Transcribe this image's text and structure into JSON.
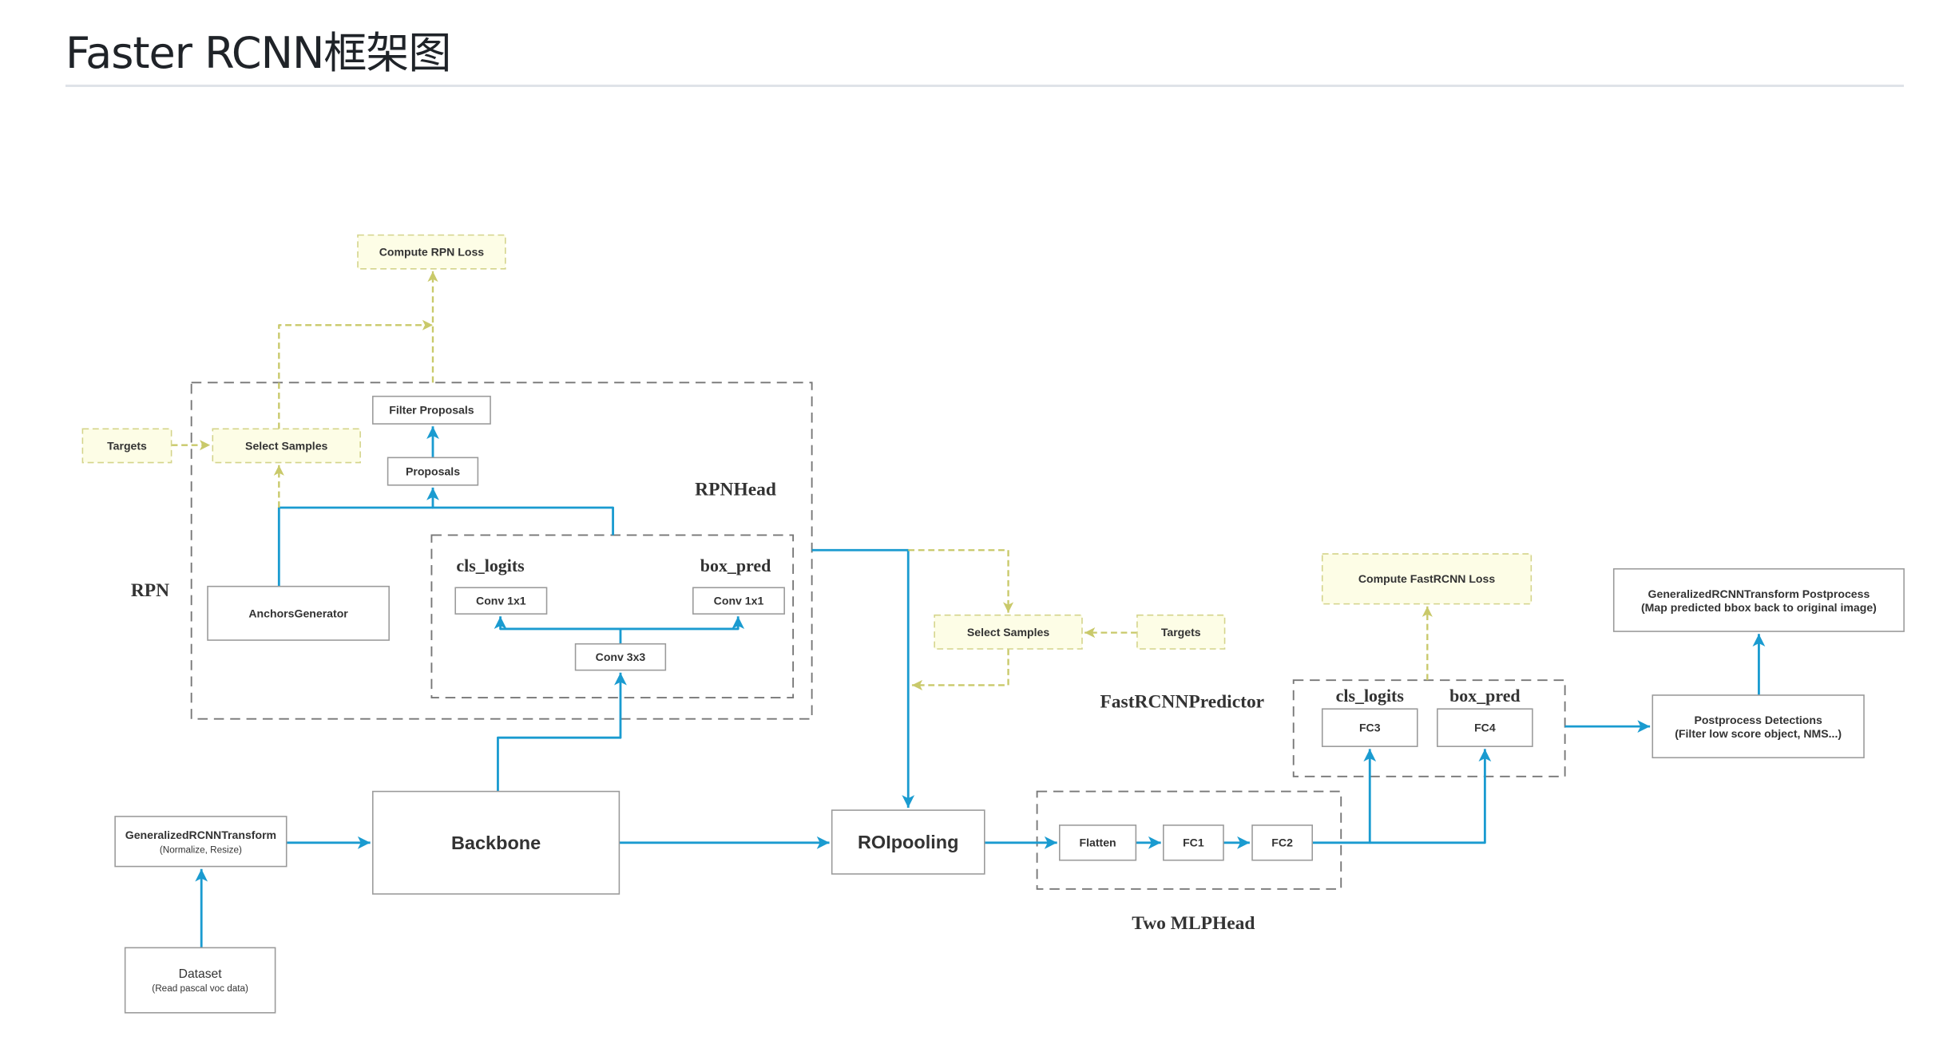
{
  "page": {
    "title": "Faster RCNN框架图"
  },
  "colors": {
    "flow": "#1a9bd0",
    "loss_flow": "#c9c96a",
    "loss_fill": "#fdfde6",
    "loss_stroke": "#d4d48a",
    "box_stroke": "#9a9a9a",
    "group_stroke": "#777777",
    "text": "#333333"
  },
  "groups": {
    "rpn": "RPN",
    "rpn_head": "RPNHead",
    "two_mlp_head": "Two MLPHead",
    "fast_rcnn_predictor": "FastRCNNPredictor"
  },
  "nodes": {
    "compute_rpn_loss": {
      "label": "Compute RPN Loss"
    },
    "targets_rpn": {
      "label": "Targets"
    },
    "select_samples_rpn": {
      "label": "Select Samples"
    },
    "filter_proposals": {
      "label": "Filter Proposals"
    },
    "proposals": {
      "label": "Proposals"
    },
    "anchors_generator": {
      "label": "AnchorsGenerator"
    },
    "rpn_cls_logits_conv": {
      "label": "Conv 1x1",
      "caption": "cls_logits"
    },
    "rpn_box_pred_conv": {
      "label": "Conv 1x1",
      "caption": "box_pred"
    },
    "conv3x3": {
      "label": "Conv 3x3"
    },
    "transform": {
      "label": "GeneralizedRCNNTransform",
      "sub": "(Normalize, Resize)"
    },
    "dataset": {
      "label": "Dataset",
      "sub": "(Read pascal voc data)"
    },
    "backbone": {
      "label": "Backbone"
    },
    "roi_pooling": {
      "label": "ROIpooling"
    },
    "select_samples_fast": {
      "label": "Select Samples"
    },
    "targets_fast": {
      "label": "Targets"
    },
    "flatten": {
      "label": "Flatten"
    },
    "fc1": {
      "label": "FC1"
    },
    "fc2": {
      "label": "FC2"
    },
    "fc3": {
      "label": "FC3",
      "caption": "cls_logits"
    },
    "fc4": {
      "label": "FC4",
      "caption": "box_pred"
    },
    "compute_fast_loss": {
      "label": "Compute FastRCNN Loss"
    },
    "postprocess": {
      "label": "Postprocess Detections",
      "sub": "(Filter low score object,  NMS...)"
    },
    "transform_post": {
      "label": "GeneralizedRCNNTransform    Postprocess",
      "sub": "(Map predicted bbox back to original image)"
    }
  }
}
